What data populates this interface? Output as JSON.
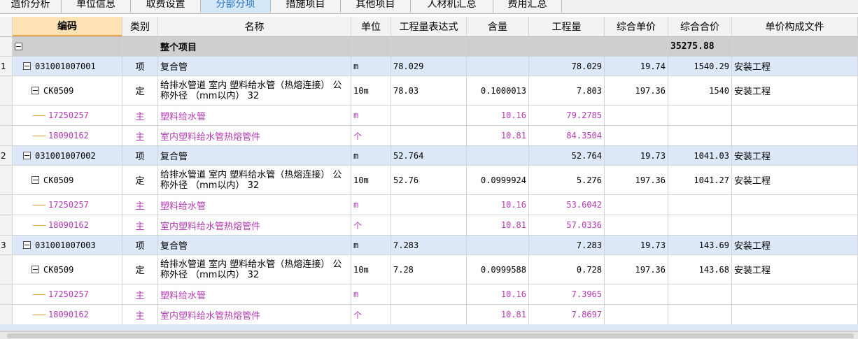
{
  "tabs": [
    "造价分析",
    "单位信息",
    "取费设置",
    "分部分项",
    "措施项目",
    "其他项目",
    "人材机汇总",
    "费用汇总"
  ],
  "active_tab": 3,
  "columns": [
    "编码",
    "类别",
    "名称",
    "单位",
    "工程量表达式",
    "含量",
    "工程量",
    "综合单价",
    "综合合价",
    "单价构成文件"
  ],
  "group": {
    "name": "整个项目",
    "total": "35275.88"
  },
  "items": [
    {
      "num": "1",
      "code": "031001007001",
      "type": "项",
      "name": "复合管",
      "unit": "m",
      "expr": "78.029",
      "content": "",
      "qty": "78.029",
      "price": "19.74",
      "total": "1540.29",
      "file": "安装工程",
      "quota": {
        "code": "CK0509",
        "type": "定",
        "name": "给排水管道 室内 塑料给水管（热熔连接） 公称外径 （mm以内） 32",
        "unit": "10m",
        "expr": "78.03",
        "content": "0.1000013",
        "qty": "7.803",
        "price": "197.36",
        "total": "1540",
        "file": "安装工程"
      },
      "materials": [
        {
          "code": "17250257",
          "type": "主",
          "name": "塑料给水管",
          "unit": "m",
          "content": "10.16",
          "qty": "79.2785"
        },
        {
          "code": "18090162",
          "type": "主",
          "name": "室内塑料给水管热熔管件",
          "unit": "个",
          "content": "10.81",
          "qty": "84.3504"
        }
      ]
    },
    {
      "num": "2",
      "code": "031001007002",
      "type": "项",
      "name": "复合管",
      "unit": "m",
      "expr": "52.764",
      "content": "",
      "qty": "52.764",
      "price": "19.73",
      "total": "1041.03",
      "file": "安装工程",
      "quota": {
        "code": "CK0509",
        "type": "定",
        "name": "给排水管道 室内 塑料给水管（热熔连接） 公称外径 （mm以内） 32",
        "unit": "10m",
        "expr": "52.76",
        "content": "0.0999924",
        "qty": "5.276",
        "price": "197.36",
        "total": "1041.27",
        "file": "安装工程"
      },
      "materials": [
        {
          "code": "17250257",
          "type": "主",
          "name": "塑料给水管",
          "unit": "m",
          "content": "10.16",
          "qty": "53.6042"
        },
        {
          "code": "18090162",
          "type": "主",
          "name": "室内塑料给水管热熔管件",
          "unit": "个",
          "content": "10.81",
          "qty": "57.0336"
        }
      ]
    },
    {
      "num": "3",
      "code": "031001007003",
      "type": "项",
      "name": "复合管",
      "unit": "m",
      "expr": "7.283",
      "content": "",
      "qty": "7.283",
      "price": "19.73",
      "total": "143.69",
      "file": "安装工程",
      "quota": {
        "code": "CK0509",
        "type": "定",
        "name": "给排水管道 室内 塑料给水管（热熔连接） 公称外径 （mm以内） 32",
        "unit": "10m",
        "expr": "7.28",
        "content": "0.0999588",
        "qty": "0.728",
        "price": "197.36",
        "total": "143.68",
        "file": "安装工程"
      },
      "materials": [
        {
          "code": "17250257",
          "type": "主",
          "name": "塑料给水管",
          "unit": "m",
          "content": "10.16",
          "qty": "7.3965"
        },
        {
          "code": "18090162",
          "type": "主",
          "name": "室内塑料给水管热熔管件",
          "unit": "个",
          "content": "10.81",
          "qty": "7.8697"
        }
      ]
    }
  ]
}
